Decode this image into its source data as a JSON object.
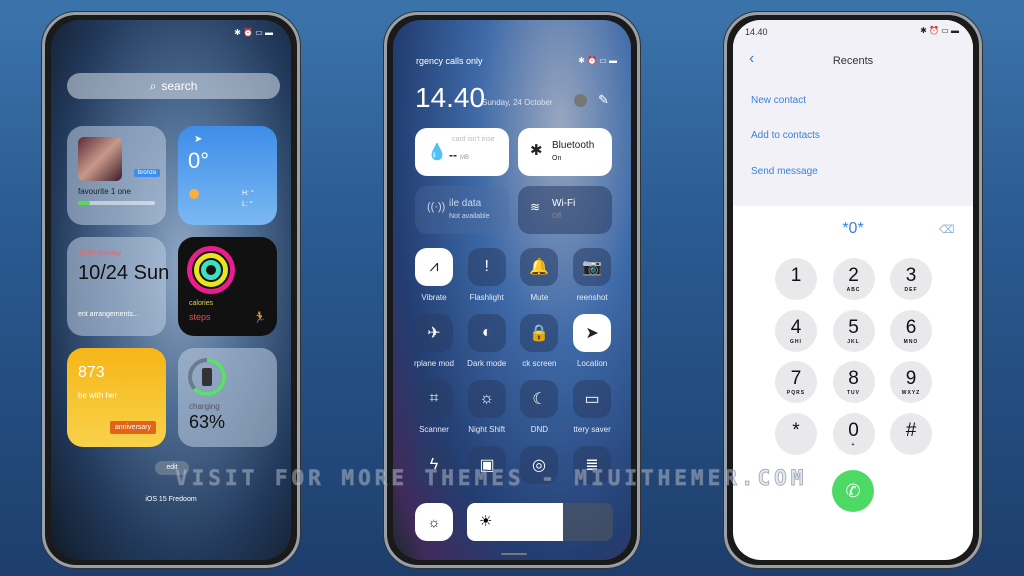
{
  "phone1": {
    "search_label": "search",
    "music": {
      "title": "favourite 1 one",
      "badge": "bronze",
      "progress": 0.15
    },
    "weather": {
      "temp": "0°",
      "high": "H: °",
      "low": "L: °"
    },
    "calendar": {
      "date_small": "10/24 Sunday",
      "date_big": "10/24 Sun",
      "event": "ent arrangements..."
    },
    "activity": {
      "calories": "calories",
      "steps": "steps"
    },
    "anniversary": {
      "count": "873",
      "text": "be with her",
      "badge": "anniversary"
    },
    "battery": {
      "label": "charging",
      "percent": "63%",
      "level": 0.63
    },
    "edit_label": "edit",
    "theme_name": "iOS 15 Fredoom"
  },
  "phone2": {
    "status": "rgency calls only",
    "time": "14.40",
    "date": "Sunday, 24 October",
    "tiles": [
      {
        "title": "card isn't inse",
        "sub": "--",
        "unit": "MB"
      },
      {
        "title": "Bluetooth",
        "sub": "On"
      },
      {
        "title": "ile data",
        "sub": "Not available"
      },
      {
        "title": "Wi-Fi",
        "sub": "Off"
      }
    ],
    "toggles": [
      {
        "label": "Vibrate",
        "icon": "vibrate-icon",
        "on": true
      },
      {
        "label": "Flashlight",
        "icon": "flashlight-icon",
        "on": false
      },
      {
        "label": "Mute",
        "icon": "bell-icon",
        "on": false
      },
      {
        "label": "reenshot",
        "icon": "camera-icon",
        "on": false
      },
      {
        "label": "rplane mod",
        "icon": "airplane-icon",
        "on": false
      },
      {
        "label": "Dark mode",
        "icon": "dark-mode-icon",
        "on": false
      },
      {
        "label": "ck screen",
        "icon": "lock-icon",
        "on": false
      },
      {
        "label": "Location",
        "icon": "location-icon",
        "on": true
      },
      {
        "label": "Scanner",
        "icon": "scanner-icon",
        "on": false
      },
      {
        "label": "Night Shift",
        "icon": "night-shift-icon",
        "on": false
      },
      {
        "label": "DND",
        "icon": "moon-icon",
        "on": false
      },
      {
        "label": "ttery saver",
        "icon": "battery-icon",
        "on": false
      }
    ],
    "brightness": 0.66
  },
  "phone3": {
    "time": "14.40",
    "title": "Recents",
    "links": [
      "New contact",
      "Add to contacts",
      "Send message"
    ],
    "dialed": "*0*",
    "keys": [
      [
        "1",
        ""
      ],
      [
        "2",
        "ABC"
      ],
      [
        "3",
        "DEF"
      ],
      [
        "4",
        "GHI"
      ],
      [
        "5",
        "JKL"
      ],
      [
        "6",
        "MNO"
      ],
      [
        "7",
        "PQRS"
      ],
      [
        "8",
        "TUV"
      ],
      [
        "9",
        "WXYZ"
      ],
      [
        "*",
        ""
      ],
      [
        "0",
        "+"
      ],
      [
        "#",
        ""
      ]
    ],
    "call_color": "#4cd964"
  },
  "watermark": "VISIT FOR MORE THEMES - MIUITHEMER.COM"
}
